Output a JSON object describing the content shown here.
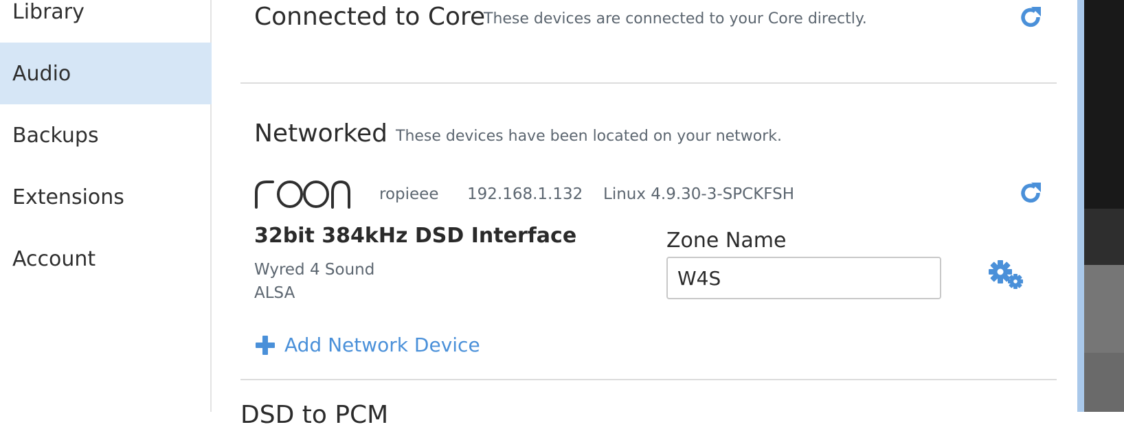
{
  "sidebar": {
    "items": [
      {
        "label": "Library",
        "active": false
      },
      {
        "label": "Audio",
        "active": true
      },
      {
        "label": "Backups",
        "active": false
      },
      {
        "label": "Extensions",
        "active": false
      },
      {
        "label": "Account",
        "active": false
      }
    ]
  },
  "sections": {
    "connected": {
      "title": "Connected to Core",
      "description": "These devices are connected to your Core directly."
    },
    "networked": {
      "title": "Networked",
      "description": "These devices have been located on your network."
    },
    "dsd": {
      "title": "DSD to PCM"
    }
  },
  "device": {
    "brand_logo": "roon",
    "host": "ropieee",
    "ip": "192.168.1.132",
    "os": "Linux 4.9.30-3-SPCKFSH",
    "name": "32bit 384kHz DSD Interface",
    "manufacturer": "Wyred 4 Sound",
    "driver": "ALSA",
    "zone_label": "Zone Name",
    "zone_value": "W4S"
  },
  "actions": {
    "add_network_device": "Add Network Device"
  },
  "icons": {
    "refresh": "refresh-icon",
    "gear": "gears-icon",
    "plus": "plus-icon"
  },
  "colors": {
    "accent": "#4a90d9",
    "sidebar_active": "#d6e6f6"
  }
}
